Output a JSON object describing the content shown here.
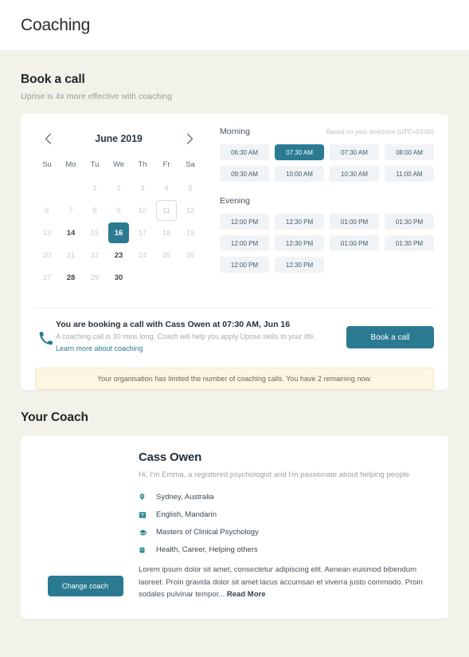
{
  "header": {
    "title": "Coaching"
  },
  "book": {
    "title": "Book a call",
    "subtitle": "Uprise is 4x more effective with coaching"
  },
  "calendar": {
    "month_label": "June 2019",
    "prev_icon": "chevron-left-icon",
    "next_icon": "chevron-right-icon",
    "weekdays": [
      "Su",
      "Mo",
      "Tu",
      "We",
      "Th",
      "Fr",
      "Sa"
    ],
    "leading_blanks": 2,
    "days": [
      {
        "n": "1",
        "state": "disabled"
      },
      {
        "n": "2",
        "state": "disabled"
      },
      {
        "n": "3",
        "state": "disabled"
      },
      {
        "n": "4",
        "state": "disabled"
      },
      {
        "n": "5",
        "state": "disabled"
      },
      {
        "n": "6",
        "state": "disabled"
      },
      {
        "n": "7",
        "state": "disabled"
      },
      {
        "n": "8",
        "state": "disabled"
      },
      {
        "n": "9",
        "state": "disabled"
      },
      {
        "n": "10",
        "state": "disabled"
      },
      {
        "n": "11",
        "state": "today"
      },
      {
        "n": "12",
        "state": "disabled"
      },
      {
        "n": "13",
        "state": "disabled"
      },
      {
        "n": "14",
        "state": "available"
      },
      {
        "n": "15",
        "state": "disabled"
      },
      {
        "n": "16",
        "state": "selected"
      },
      {
        "n": "17",
        "state": "disabled"
      },
      {
        "n": "18",
        "state": "disabled"
      },
      {
        "n": "19",
        "state": "disabled"
      },
      {
        "n": "20",
        "state": "disabled"
      },
      {
        "n": "21",
        "state": "disabled"
      },
      {
        "n": "22",
        "state": "disabled"
      },
      {
        "n": "23",
        "state": "available"
      },
      {
        "n": "24",
        "state": "disabled"
      },
      {
        "n": "25",
        "state": "disabled"
      },
      {
        "n": "26",
        "state": "disabled"
      },
      {
        "n": "27",
        "state": "disabled"
      },
      {
        "n": "28",
        "state": "available"
      },
      {
        "n": "29",
        "state": "disabled"
      },
      {
        "n": "30",
        "state": "available"
      }
    ]
  },
  "slots": {
    "morning_label": "Morning",
    "timezone_note": "Based on your timezone (UTC+03:00)",
    "evening_label": "Evening",
    "morning": [
      {
        "time": "06:30 AM",
        "selected": false
      },
      {
        "time": "07:30 AM",
        "selected": true
      },
      {
        "time": "07:30 AM",
        "selected": false
      },
      {
        "time": "08:00 AM",
        "selected": false
      },
      {
        "time": "09:30 AM",
        "selected": false
      },
      {
        "time": "10:00 AM",
        "selected": false
      },
      {
        "time": "10:30 AM",
        "selected": false
      },
      {
        "time": "11:00 AM",
        "selected": false
      }
    ],
    "evening": [
      {
        "time": "12:00 PM",
        "selected": false
      },
      {
        "time": "12:30 PM",
        "selected": false
      },
      {
        "time": "01:00 PM",
        "selected": false
      },
      {
        "time": "01:30 PM",
        "selected": false
      },
      {
        "time": "12:00 PM",
        "selected": false
      },
      {
        "time": "12:30 PM",
        "selected": false
      },
      {
        "time": "01:00 PM",
        "selected": false
      },
      {
        "time": "01:30 PM",
        "selected": false
      },
      {
        "time": "12:00 PM",
        "selected": false
      },
      {
        "time": "12:30 PM",
        "selected": false
      }
    ]
  },
  "confirm": {
    "icon": "phone-icon",
    "title": "You are booking a call with Cass Owen at 07:30 AM, Jun 16",
    "description": "A coaching call is 30 mins long. Coach will help you apply Uprise skills to your life.",
    "link": "Learn more about coaching",
    "button": "Book a call"
  },
  "notice": {
    "text": "Your organisation has limited the number of coaching calls. You have 2 remaining now."
  },
  "coach_section": {
    "title": "Your Coach",
    "name": "Cass Owen",
    "tagline": "Hi, I'm Emma, a registered psychologist and I'm passionate about helping people",
    "change_button": "Change coach",
    "facts": [
      {
        "icon": "location-pin-icon",
        "text": "Sydney, Australia"
      },
      {
        "icon": "language-icon",
        "text": "English, Mandarin"
      },
      {
        "icon": "graduation-cap-icon",
        "text": "Masters of Clinical Psychology"
      },
      {
        "icon": "briefcase-icon",
        "text": "Health, Career, Helping others"
      }
    ],
    "bio": "Lorem ipsum dolor sit amet, consectetur adipiscing elit. Aenean euismod bibendum laoreet. Proin gravida dolor sit amet lacus accumsan et viverra justo commodo. Proin sodales pulvinar tempor... ",
    "read_more": "Read More"
  },
  "colors": {
    "accent": "#2b7a92",
    "page_bg": "#f2f1ea",
    "card_bg": "#ffffff",
    "notice_bg": "#fdf6e3",
    "slot_bg": "#f1f4f6",
    "fact_icon": "#2f8a8a"
  }
}
